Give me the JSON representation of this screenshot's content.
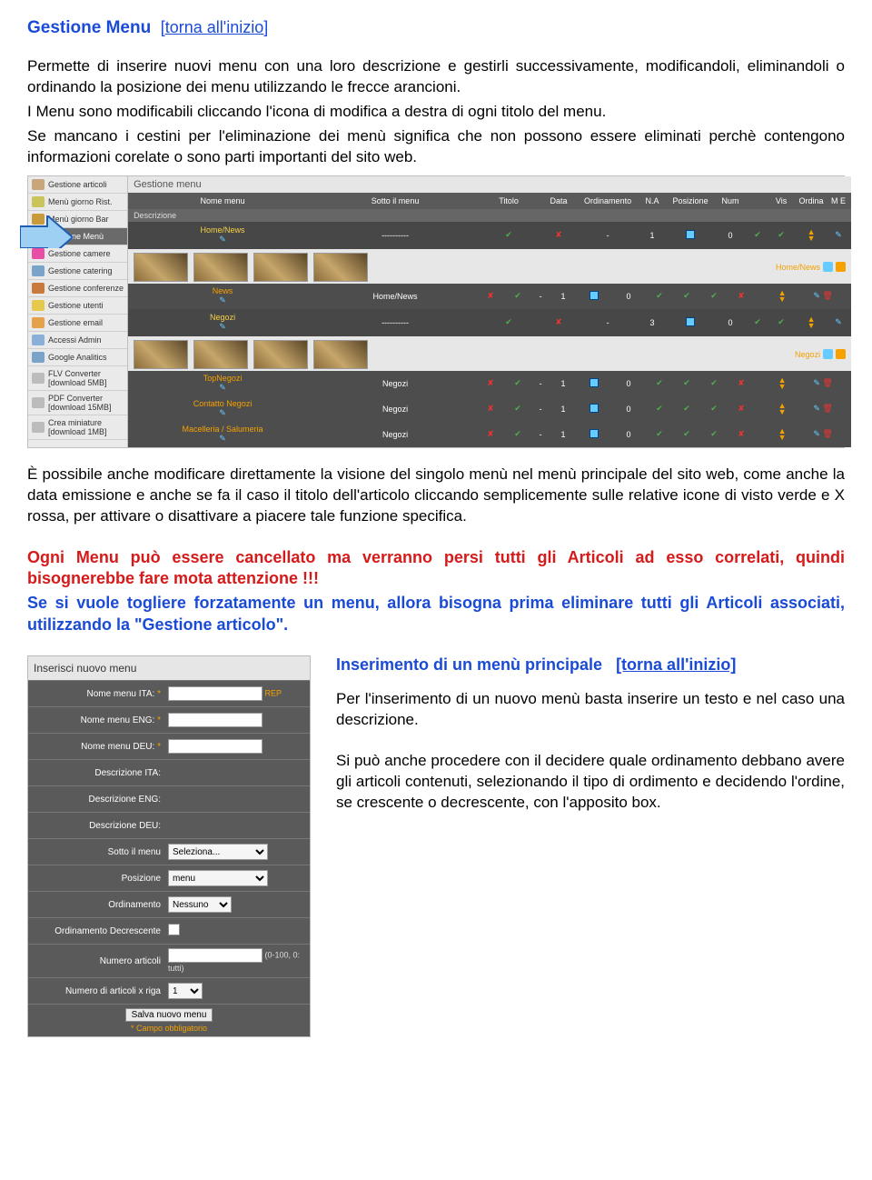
{
  "heading": "Gestione Menu",
  "back_link": "[torna all'inizio]",
  "para1": "Permette di inserire nuovi menu con una loro descrizione e gestirli successivamente, modificandoli, eliminandoli o ordinando la posizione dei menu utilizzando le frecce arancioni.",
  "para2": "I Menu sono modificabili cliccando l'icona di modifica a destra di ogni titolo del menu.",
  "para3": "Se mancano i cestini per l'eliminazione dei menù significa che non possono essere eliminati perchè contengono informazioni corelate o sono parti importanti del sito web.",
  "sidebar": {
    "items": [
      {
        "label": "Gestione articoli",
        "color": "#c9a57a"
      },
      {
        "label": "Menù giorno Rist.",
        "color": "#c9c55b"
      },
      {
        "label": "Menù giorno Bar",
        "color": "#c99a3a"
      },
      {
        "label": "Gestione Menù",
        "color": "#2a6bd1",
        "active": true
      },
      {
        "label": "Gestione camere",
        "color": "#e84ea5"
      },
      {
        "label": "Gestione catering",
        "color": "#7aa3c9"
      },
      {
        "label": "Gestione conferenze",
        "color": "#c97a3a"
      },
      {
        "label": "Gestione utenti",
        "color": "#e6c94b"
      },
      {
        "label": "Gestione email",
        "color": "#e6a24b"
      },
      {
        "label": "Accessi Admin",
        "color": "#8ab0d9"
      },
      {
        "label": "Google Analitics",
        "color": "#7aa3c9"
      },
      {
        "label": "FLV Converter\n[download 5MB]",
        "color": "#bcbcbc"
      },
      {
        "label": "PDF Converter\n[download 15MB]",
        "color": "#bcbcbc"
      },
      {
        "label": "Crea miniature\n[download 1MB]",
        "color": "#bcbcbc"
      }
    ]
  },
  "main_title": "Gestione menu",
  "columns": {
    "c1": "Nome menu",
    "c2": "Sotto il menu",
    "c3": "Titolo",
    "c4": "Data",
    "c5": "Ordinamento",
    "c6": "N.A",
    "c7": "Posizione",
    "c8": "Num",
    "c9": "",
    "c10": "Vis",
    "c11": "Ordina",
    "c12": "M E"
  },
  "desc_label": "Descrizione",
  "menus": [
    {
      "name": "Home/News",
      "under": "----------",
      "na": "1",
      "num": "0",
      "tag": "Home/News",
      "subs": [
        {
          "name": "News",
          "parent": "Home/News",
          "na": "1",
          "num": "0"
        }
      ]
    },
    {
      "name": "Negozi",
      "under": "----------",
      "na": "3",
      "num": "0",
      "tag": "Negozi",
      "subs": [
        {
          "name": "TopNegozi",
          "parent": "Negozi",
          "na": "1",
          "num": "0"
        },
        {
          "name": "Contatto Negozi",
          "parent": "Negozi",
          "na": "1",
          "num": "0"
        },
        {
          "name": "Macelleria / Salumeria",
          "parent": "Negozi",
          "na": "1",
          "num": "0"
        }
      ]
    }
  ],
  "para_after": "È possibile anche modificare direttamente la visione del singolo menù nel menù principale del sito web, come anche la data emissione e anche se fa il caso il titolo dell'articolo cliccando semplicemente sulle relative icone di visto verde e X rossa, per attivare o disattivare a piacere tale funzione specifica.",
  "warn1": "Ogni Menu può essere cancellato ma verranno persi tutti gli Articoli ad esso correlati, quindi bisognerebbe fare mota attenzione !!!",
  "warn2": "Se si vuole togliere forzatamente un menu, allora bisogna prima eliminare tutti gli Articoli associati, utilizzando la \"Gestione articolo\".",
  "form": {
    "title": "Inserisci nuovo menu",
    "rows": [
      {
        "label": "Nome menu ITA:",
        "req": true,
        "type": "text",
        "value": "",
        "hint": "REP"
      },
      {
        "label": "Nome menu ENG:",
        "req": true,
        "type": "text",
        "value": ""
      },
      {
        "label": "Nome menu DEU:",
        "req": true,
        "type": "text",
        "value": ""
      },
      {
        "label": "Descrizione ITA:",
        "type": "blank"
      },
      {
        "label": "Descrizione ENG:",
        "type": "blank"
      },
      {
        "label": "Descrizione DEU:",
        "type": "blank"
      },
      {
        "label": "Sotto il menu",
        "type": "select",
        "value": "Seleziona..."
      },
      {
        "label": "Posizione",
        "type": "select",
        "value": "menu"
      },
      {
        "label": "Ordinamento",
        "type": "select",
        "value": "Nessuno"
      },
      {
        "label": "Ordinamento Decrescente",
        "type": "checkbox"
      },
      {
        "label": "Numero articoli",
        "type": "text",
        "value": "",
        "hint2": "(0-100, 0: tutti)"
      },
      {
        "label": "Numero di articoli x riga",
        "type": "select",
        "value": "1"
      }
    ],
    "button": "Salva nuovo menu",
    "reqnote": "* Campo obbligatorio"
  },
  "insert": {
    "title": "Inserimento di un menù principale",
    "back": "[torna all'inizio]",
    "p1": "Per l'inserimento di un nuovo menù basta inserire un testo e nel caso una descrizione.",
    "p2": "Si può anche procedere con il decidere quale ordinamento debbano avere gli articoli contenuti, selezionando il tipo di ordimento e decidendo l'ordine, se crescente o decrescente, con l'apposito box."
  }
}
